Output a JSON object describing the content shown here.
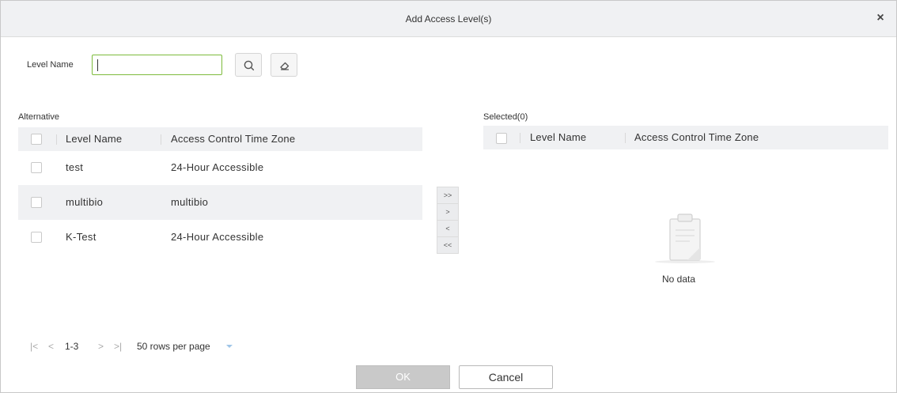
{
  "dialog": {
    "title": "Add Access Level(s)",
    "close_label": "×"
  },
  "search": {
    "label": "Level Name",
    "value": "",
    "placeholder": ""
  },
  "alternative": {
    "label": "Alternative",
    "columns": [
      "Level Name",
      "Access Control Time Zone"
    ],
    "rows": [
      {
        "name": "test",
        "time_zone": "24-Hour Accessible"
      },
      {
        "name": "multibio",
        "time_zone": "multibio"
      },
      {
        "name": "K-Test",
        "time_zone": "24-Hour Accessible"
      }
    ]
  },
  "transfer": {
    "move_all_right": ">>",
    "move_right": ">",
    "move_left": "<",
    "move_all_left": "<<"
  },
  "selected": {
    "label": "Selected(0)",
    "columns": [
      "Level Name",
      "Access Control Time Zone"
    ],
    "empty_text": "No data"
  },
  "pager": {
    "first": "|<",
    "prev": "<",
    "range": "1-3",
    "next": ">",
    "last": ">|",
    "rows_per_page": "50 rows per page"
  },
  "footer": {
    "ok_label": "OK",
    "cancel_label": "Cancel"
  },
  "colors": {
    "input_focus_border": "#7dbb3c",
    "header_bg": "#f0f1f3",
    "ok_disabled_bg": "#c9c9c9"
  }
}
